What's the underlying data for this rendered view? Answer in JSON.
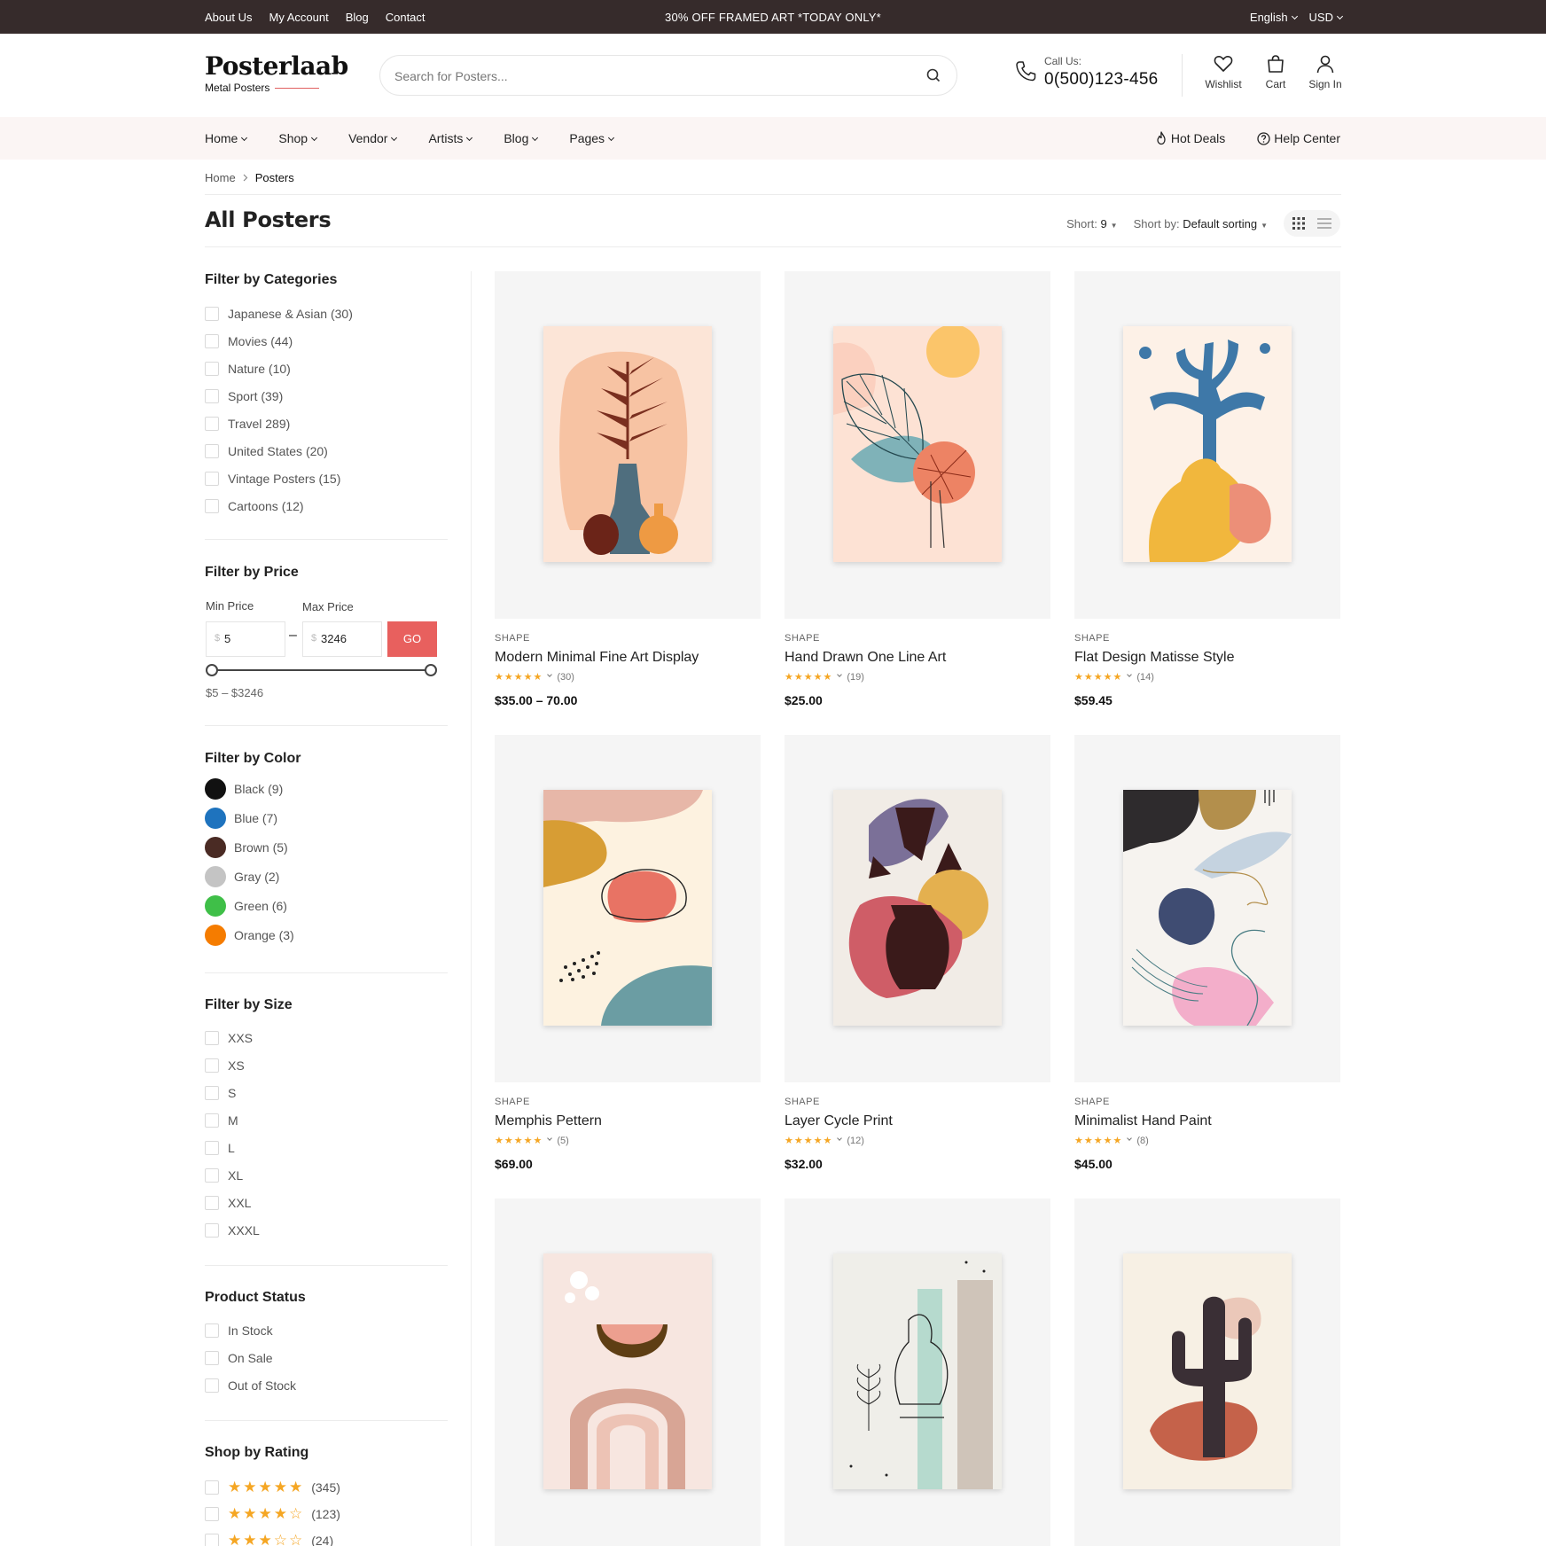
{
  "topbar": {
    "links": [
      "About Us",
      "My Account",
      "Blog",
      "Contact"
    ],
    "promo": "30% OFF FRAMED ART *TODAY ONLY*",
    "language": "English",
    "currency": "USD"
  },
  "header": {
    "logo_name": "Posterlaab",
    "logo_sub": "Metal Posters",
    "search_placeholder": "Search for Posters...",
    "call_label": "Call Us:",
    "call_number": "0(500)123-456",
    "wishlist": "Wishlist",
    "cart": "Cart",
    "signin": "Sign In"
  },
  "nav": {
    "items": [
      "Home",
      "Shop",
      "Vendor",
      "Artists",
      "Blog",
      "Pages"
    ],
    "hot_deals": "Hot Deals",
    "help_center": "Help Center"
  },
  "breadcrumb": {
    "home": "Home",
    "current": "Posters"
  },
  "page_title": "All Posters",
  "sort": {
    "short_label": "Short:",
    "short_value": "9",
    "sortby_label": "Short by:",
    "sortby_value": "Default sorting"
  },
  "filters": {
    "categories_title": "Filter by Categories",
    "categories": [
      "Japanese & Asian (30)",
      "Movies (44)",
      "Nature (10)",
      "Sport (39)",
      "Travel 289)",
      "United States (20)",
      "Vintage Posters (15)",
      "Cartoons (12)"
    ],
    "price_title": "Filter by Price",
    "min_label": "Min Price",
    "max_label": "Max Price",
    "currency_symbol": "$",
    "min_value": "5",
    "max_value": "3246",
    "go_label": "GO",
    "range_text": "$5 – $3246",
    "color_title": "Filter by Color",
    "colors": [
      {
        "label": "Black (9)",
        "color": "#111111"
      },
      {
        "label": "Blue (7)",
        "color": "#1e73be"
      },
      {
        "label": "Brown (5)",
        "color": "#4a2b24"
      },
      {
        "label": "Gray (2)",
        "color": "#c4c4c4"
      },
      {
        "label": "Green (6)",
        "color": "#3fbf48"
      },
      {
        "label": "Orange (3)",
        "color": "#f57c00"
      }
    ],
    "size_title": "Filter by Size",
    "sizes": [
      "XXS",
      "XS",
      "S",
      "M",
      "L",
      "XL",
      "XXL",
      "XXXL"
    ],
    "status_title": "Product Status",
    "statuses": [
      "In Stock",
      "On Sale",
      "Out of Stock"
    ],
    "rating_title": "Shop by Rating",
    "ratings": [
      {
        "stars": 5,
        "count": "(345)"
      },
      {
        "stars": 4,
        "count": "(123)"
      },
      {
        "stars": 3,
        "count": "(24)"
      }
    ]
  },
  "products": [
    {
      "category": "SHAPE",
      "title": "Modern Minimal Fine Art Display",
      "reviews": "(30)",
      "price": "$35.00 – 70.00"
    },
    {
      "category": "SHAPE",
      "title": "Hand Drawn One Line Art",
      "reviews": "(19)",
      "price": "$25.00"
    },
    {
      "category": "SHAPE",
      "title": "Flat Design Matisse Style",
      "reviews": "(14)",
      "price": "$59.45"
    },
    {
      "category": "SHAPE",
      "title": "Memphis Pettern",
      "reviews": "(5)",
      "price": "$69.00"
    },
    {
      "category": "SHAPE",
      "title": "Layer Cycle Print",
      "reviews": "(12)",
      "price": "$32.00"
    },
    {
      "category": "SHAPE",
      "title": "Minimalist Hand Paint",
      "reviews": "(8)",
      "price": "$45.00"
    },
    {
      "category": "",
      "title": "",
      "reviews": "",
      "price": ""
    },
    {
      "category": "",
      "title": "",
      "reviews": "",
      "price": ""
    },
    {
      "category": "",
      "title": "",
      "reviews": "",
      "price": ""
    }
  ],
  "star_glyph": "★★★★★"
}
